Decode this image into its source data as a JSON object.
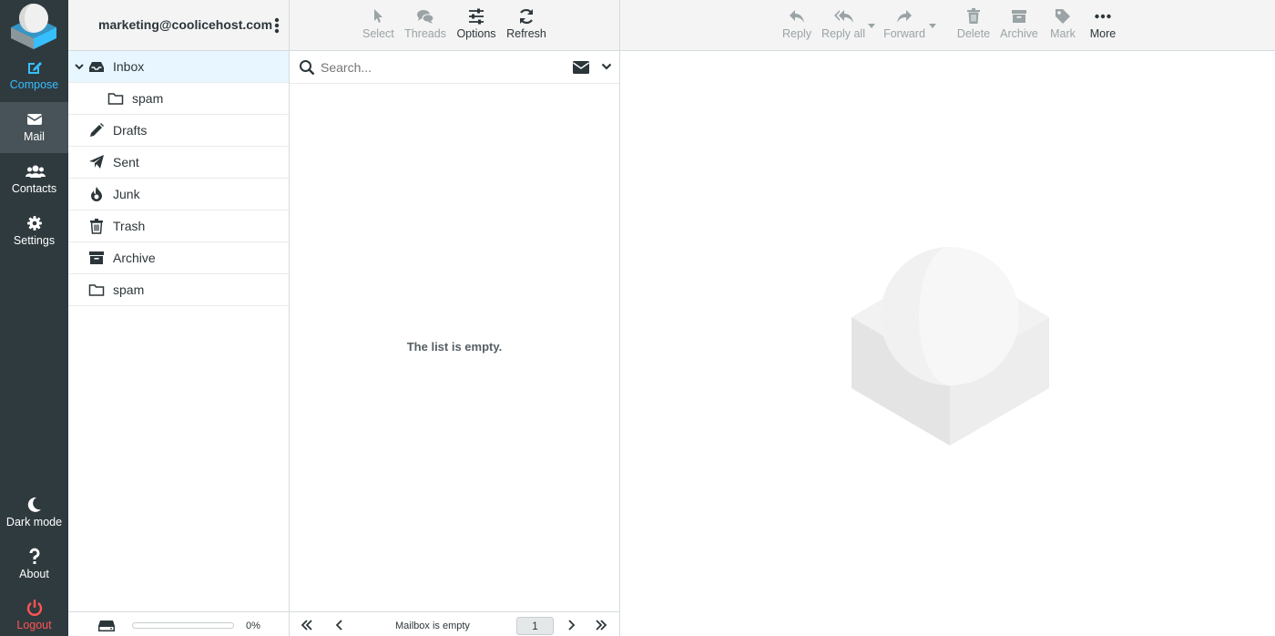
{
  "taskmenu": {
    "compose": "Compose",
    "mail": "Mail",
    "contacts": "Contacts",
    "settings": "Settings",
    "darkmode": "Dark mode",
    "about": "About",
    "logout": "Logout"
  },
  "account": {
    "email": "marketing@coolicehost.com"
  },
  "folders": [
    {
      "label": "Inbox",
      "icon": "inbox-icon"
    },
    {
      "label": "spam",
      "icon": "folder-icon"
    },
    {
      "label": "Drafts",
      "icon": "pencil-icon"
    },
    {
      "label": "Sent",
      "icon": "paper-plane-icon"
    },
    {
      "label": "Junk",
      "icon": "fire-icon"
    },
    {
      "label": "Trash",
      "icon": "trash-icon"
    },
    {
      "label": "Archive",
      "icon": "archive-icon"
    },
    {
      "label": "spam",
      "icon": "folder-icon"
    }
  ],
  "quota": {
    "percent": "0%",
    "fraction": 0
  },
  "list_toolbar": {
    "select": "Select",
    "threads": "Threads",
    "options": "Options",
    "refresh": "Refresh"
  },
  "search": {
    "placeholder": "Search...",
    "value": ""
  },
  "list": {
    "empty_message": "The list is empty."
  },
  "pager": {
    "status": "Mailbox is empty",
    "page": "1"
  },
  "message_toolbar": {
    "reply": "Reply",
    "reply_all": "Reply all",
    "forward": "Forward",
    "delete": "Delete",
    "archive": "Archive",
    "mark": "Mark",
    "more": "More"
  },
  "colors": {
    "sidebar": "#2f3a3f",
    "accent": "#37beff",
    "logout": "#ff5552",
    "selected_folder": "#e8f7ff"
  }
}
